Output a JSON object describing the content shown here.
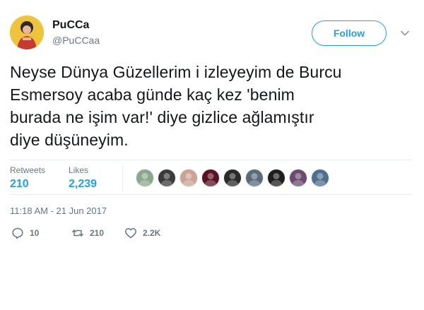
{
  "user": {
    "display_name": "PuCCa",
    "handle": "@PuCCaa",
    "avatar_icon": "profile-photo"
  },
  "follow_button": {
    "label": "Follow"
  },
  "more_menu": {
    "icon": "chevron-down-icon"
  },
  "tweet": {
    "text": "Neyse Dünya Güzellerim i izleyeyim de Burcu\nEsmersoy acaba günde kaç kez 'benim\nburada ne işim var!' diye gizlice ağlamıştır\ndiye düşüneyim."
  },
  "stats": {
    "retweets_label": "Retweets",
    "retweets_value": "210",
    "likes_label": "Likes",
    "likes_value": "2,239"
  },
  "likers": [
    {
      "color": "#8aa98c"
    },
    {
      "color": "#3b3b3b"
    },
    {
      "color": "#c9a394"
    },
    {
      "color": "#5b1024"
    },
    {
      "color": "#2a2a2a"
    },
    {
      "color": "#5a6b7a"
    },
    {
      "color": "#1e1e1e"
    },
    {
      "color": "#6b4a6e"
    },
    {
      "color": "#4f6f8f"
    }
  ],
  "timestamp": "11:18 AM - 21 Jun 2017",
  "actions": {
    "reply_count": "10",
    "retweet_count": "210",
    "like_count": "2.2K"
  },
  "colors": {
    "accent": "#1da1f2",
    "secondary_text": "#657786",
    "divider": "#e6ecf0"
  }
}
